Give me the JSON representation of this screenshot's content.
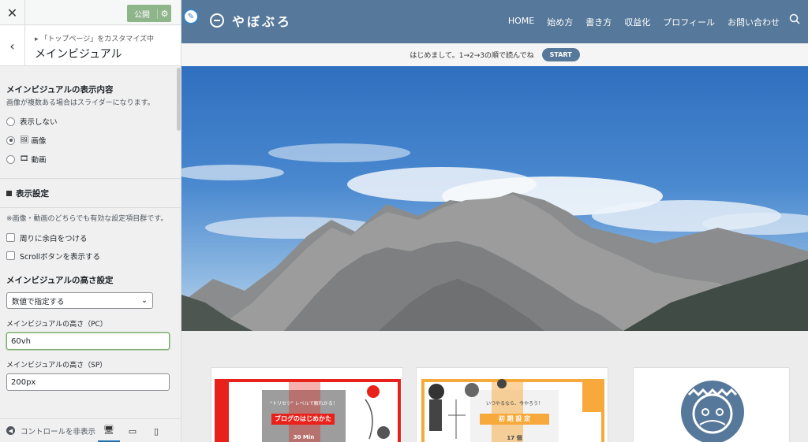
{
  "customizer": {
    "publish_label": "公開",
    "breadcrumb": "「トップページ」をカスタマイズ中",
    "section_title": "メインビジュアル",
    "display_heading": "メインビジュアルの表示内容",
    "display_desc": "画像が複数ある場合はスライダーになります。",
    "display_options": [
      {
        "label": "表示しない",
        "selected": false
      },
      {
        "label": "画像",
        "selected": true
      },
      {
        "label": "動画",
        "selected": false
      }
    ],
    "settings_heading": "表示設定",
    "settings_desc": "画像・動画のどちらでも有効な設定項目群です。",
    "checkbox_margin": "周りに余白をつける",
    "checkbox_scroll": "Scrollボタンを表示する",
    "height_heading": "メインビジュアルの高さ設定",
    "height_select": "数値で指定する",
    "pc_label": "メインビジュアルの高さ（PC）",
    "pc_value": "60vh",
    "sp_label": "メインビジュアルの高さ（SP）",
    "sp_value": "200px",
    "footer_label": "コントロールを非表示"
  },
  "site": {
    "logo_text": "やぼぶろ",
    "nav": [
      "HOME",
      "始め方",
      "書き方",
      "収益化",
      "プロフィール",
      "お問い合わせ"
    ],
    "notice_text": "はじめまして。1→2→3の順で読んでね",
    "notice_button": "START"
  },
  "cards": [
    {
      "tag": "\"トリセツ\" レベルで解れかる！",
      "title": "ブログのはじめかた",
      "meta": "30 Min"
    },
    {
      "tag": "いつやるなら、今やろう！",
      "title": "初 期 設 定",
      "meta": "17 個"
    }
  ],
  "colors": {
    "header": "#56789a",
    "publish": "#8fb58b",
    "card_red": "#e8221b",
    "card_orange": "#f7a93b"
  }
}
